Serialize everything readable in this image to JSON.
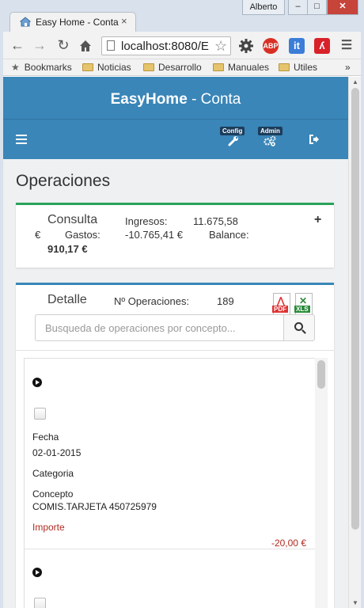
{
  "window": {
    "user": "Alberto",
    "controls": [
      "–",
      "□",
      "✕"
    ]
  },
  "tab": {
    "title": "Easy Home - Conta",
    "close": "×"
  },
  "toolbar": {
    "url": "localhost:8080/E",
    "extensions": {
      "abp_label": "ABP",
      "it_label": "it",
      "abp_color": "#d93025",
      "it_color": "#3b7dd8",
      "avira_color": "#d8222a"
    }
  },
  "bookmarks": {
    "items": [
      "Bookmarks",
      "Noticias",
      "Desarrollo",
      "Manuales",
      "Utiles"
    ],
    "more": "»"
  },
  "app": {
    "brand": "EasyHome",
    "subtitle": "- Conta",
    "nav": {
      "config_label": "Config",
      "admin_label": "Admin"
    },
    "colors": {
      "header": "#3a86b8",
      "consulta_accent": "#29a25a",
      "detalle_accent": "#3a86b8",
      "importe_red": "#b02a20"
    }
  },
  "page": {
    "title": "Operaciones"
  },
  "consulta": {
    "title": "Consulta",
    "ingresos_label": "Ingresos:",
    "ingresos_value": "11.675,58",
    "euro": "€",
    "gastos_label": "Gastos:",
    "gastos_value": "-10.765,41 €",
    "balance_label": "Balance:",
    "balance_value": "910,17 €",
    "expand": "+"
  },
  "detalle": {
    "title": "Detalle",
    "ops_label": "Nº Operaciones:",
    "ops_value": "189",
    "pdf_tag": "PDF",
    "xls_tag": "XLS",
    "search_placeholder": "Busqueda de operaciones por concepto..."
  },
  "operations": [
    {
      "fecha_label": "Fecha",
      "fecha": "02-01-2015",
      "categoria_label": "Categoria",
      "concepto_label": "Concepto",
      "concepto": "COMIS.TARJETA 450725979",
      "importe_label": "Importe",
      "importe": "-20,00 €"
    }
  ]
}
